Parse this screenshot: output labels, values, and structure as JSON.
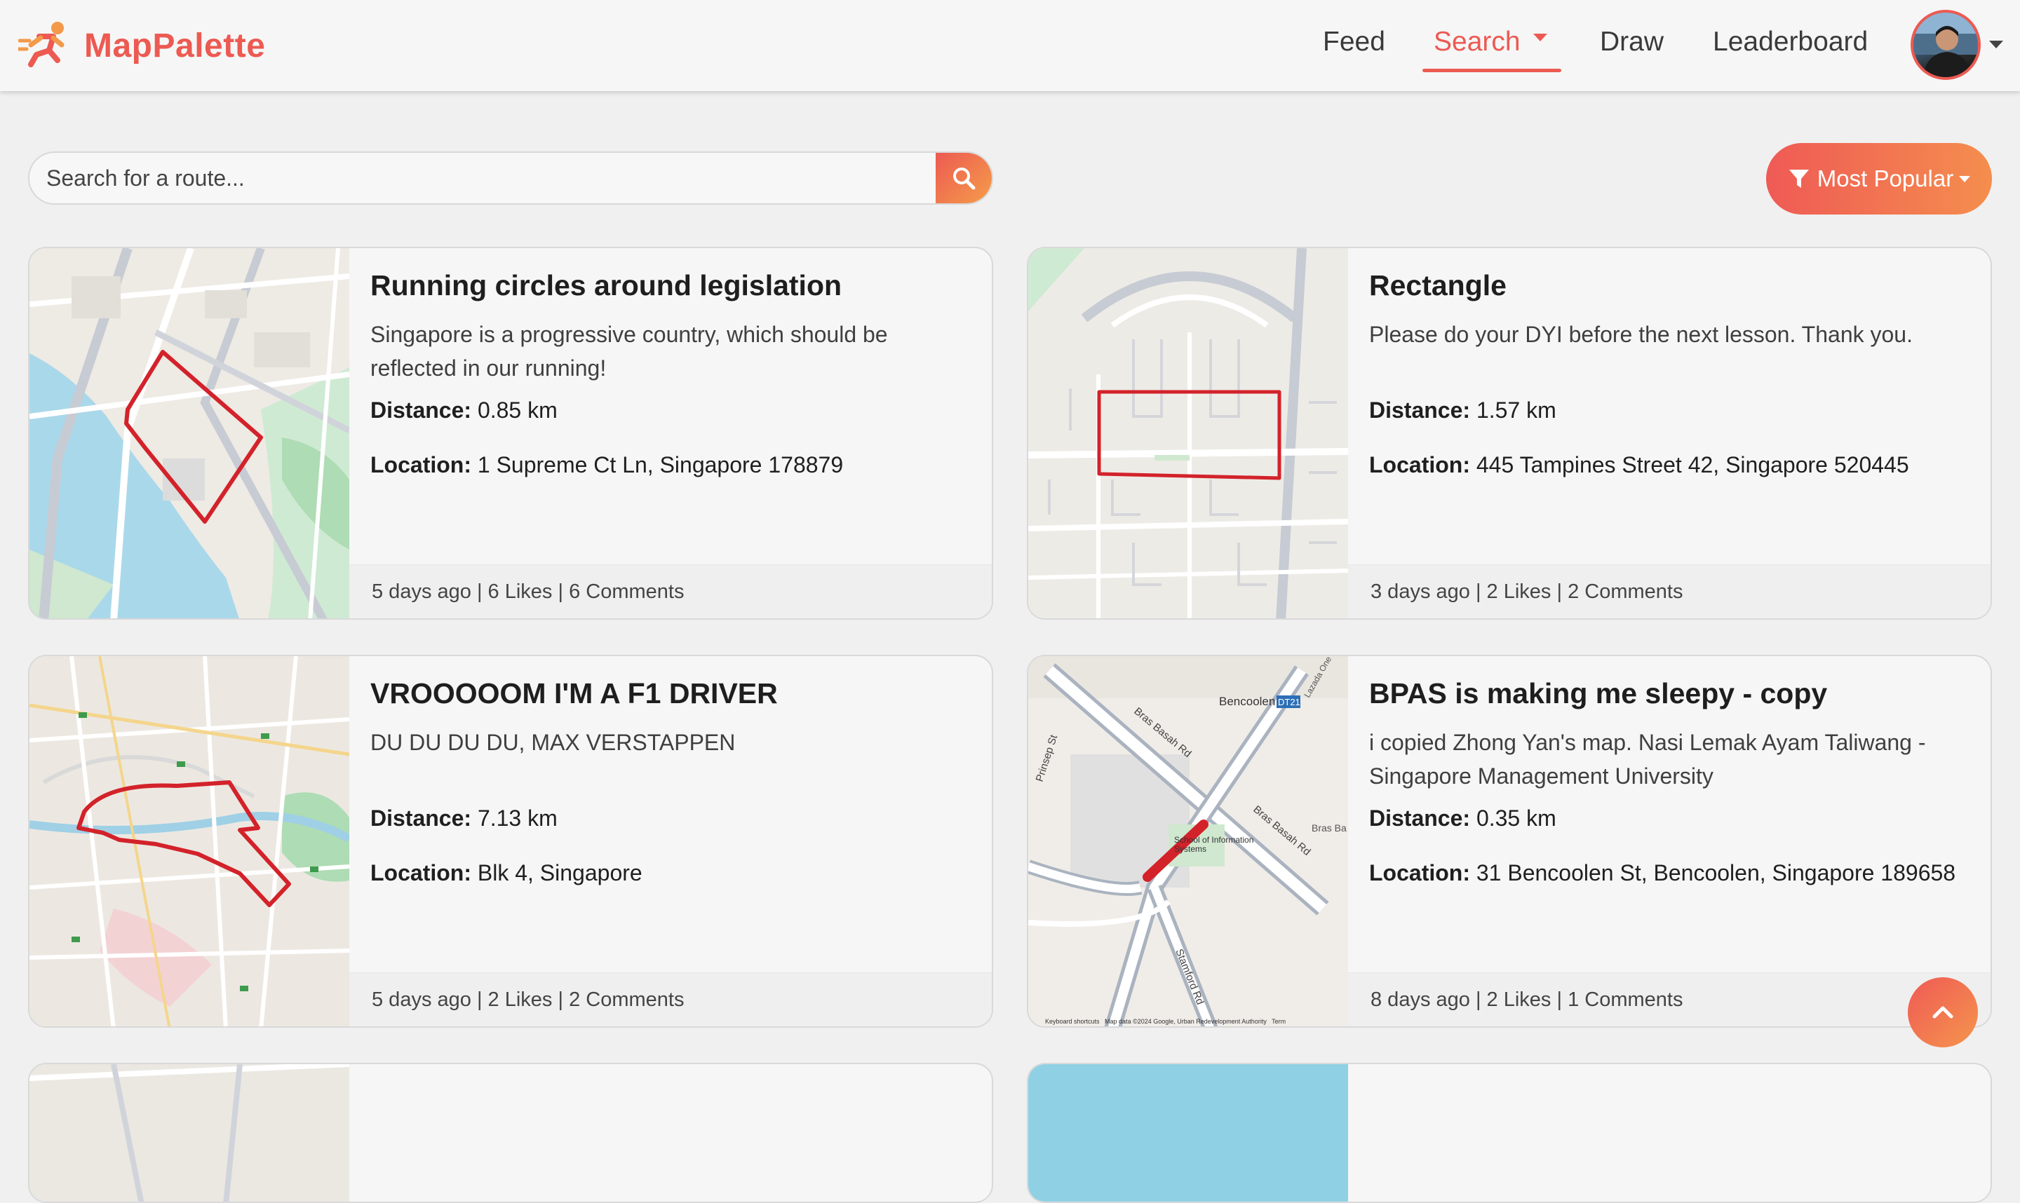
{
  "brand": {
    "name": "MapPalette"
  },
  "nav": {
    "feed": "Feed",
    "search": "Search",
    "draw": "Draw",
    "leaderboard": "Leaderboard"
  },
  "search": {
    "placeholder": "Search for a route...",
    "value": ""
  },
  "filter": {
    "label": "Most Popular"
  },
  "labels": {
    "distance": "Distance:",
    "location": "Location:"
  },
  "cards": [
    {
      "title": "Running circles around legislation",
      "description": "Singapore is a progressive country, which should be reflected in our running!",
      "distance": "0.85 km",
      "location": "1 Supreme Ct Ln, Singapore 178879",
      "meta": "5 days ago | 6 Likes | 6 Comments"
    },
    {
      "title": "Rectangle",
      "description": "Please do your DYI before the next lesson. Thank you.",
      "distance": "1.57 km",
      "location": "445 Tampines Street 42, Singapore 520445",
      "meta": "3 days ago | 2 Likes | 2 Comments"
    },
    {
      "title": "VROOOOOM I'M A F1 DRIVER",
      "description": "DU DU DU DU, MAX VERSTAPPEN",
      "distance": "7.13 km",
      "location": "Blk 4, Singapore",
      "meta": "5 days ago | 2 Likes | 2 Comments"
    },
    {
      "title": "BPAS is making me sleepy - copy",
      "description": "i copied Zhong Yan's map. Nasi Lemak Ayam Taliwang - Singapore Management University",
      "distance": "0.35 km",
      "location": "31 Bencoolen St, Bencoolen, Singapore 189658",
      "meta": "8 days ago | 2 Likes | 1 Comments"
    }
  ],
  "map_labels": {
    "bencoolen": "Bencoolen",
    "station_code": "DT21",
    "bras_basah_1": "Bras Basah Rd",
    "bras_basah_2": "Bras Basah Rd",
    "bras_ba": "Bras Ba",
    "prinsep": "Prinsep St",
    "stamford": "Stamford Rd",
    "school": "School of Information Systems",
    "lazada": "Lazada One",
    "attribution": "Keyboard shortcuts   Map data ©2024 Google, Urban Redevelopment Authority   Term"
  },
  "colors": {
    "accent": "#ec5a52",
    "accent2": "#f59d4a",
    "route": "#d3222a"
  },
  "icons": {
    "brand": "runner-logo-icon",
    "search": "search-icon",
    "filter": "filter-icon",
    "back_to_top": "chevron-up-icon"
  }
}
